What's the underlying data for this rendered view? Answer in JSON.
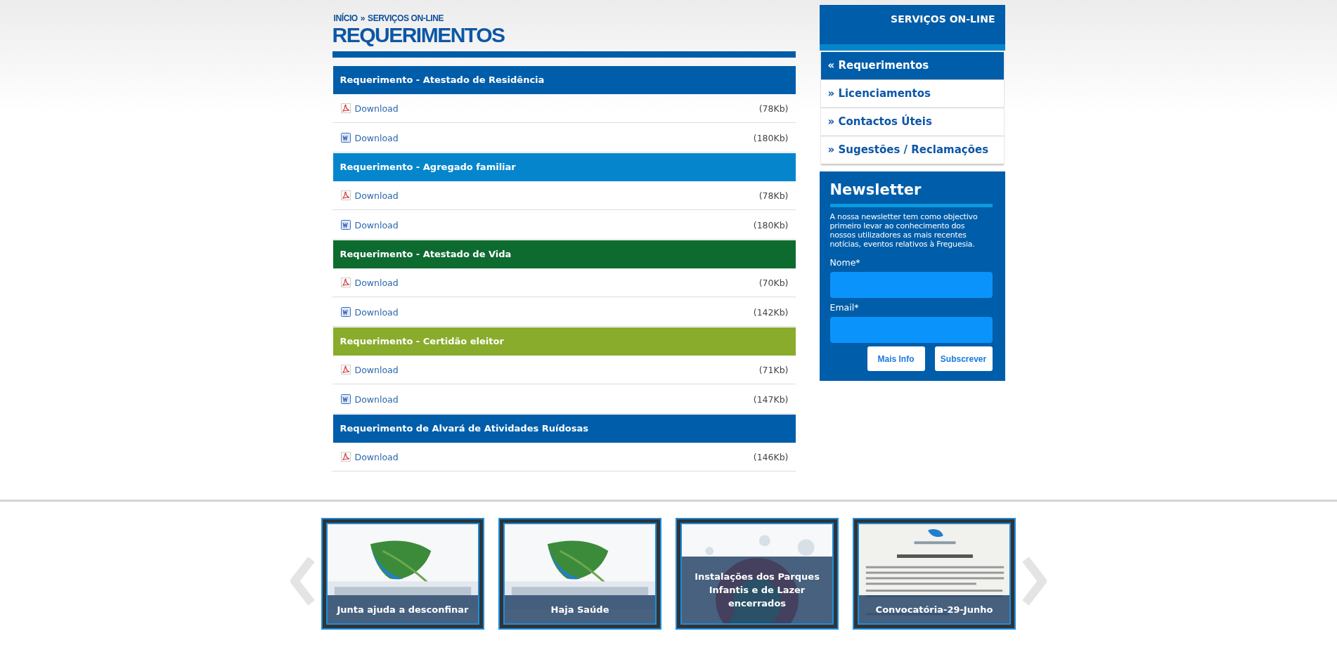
{
  "breadcrumb": [
    "INÍCIO",
    "»",
    "SERVIÇOS ON-LINE"
  ],
  "title": "REQUERIMENTOS",
  "sections": [
    {
      "title": "Requerimento - Atestado de Residência",
      "color": "#005da9",
      "files": [
        {
          "kind": "pdf",
          "label": "Download",
          "size": "(78Kb)"
        },
        {
          "kind": "word",
          "label": "Download",
          "size": "(180Kb)"
        }
      ]
    },
    {
      "title": "Requerimento - Agregado familiar",
      "color": "#0586cc",
      "files": [
        {
          "kind": "pdf",
          "label": "Download",
          "size": "(78Kb)"
        },
        {
          "kind": "word",
          "label": "Download",
          "size": "(180Kb)"
        }
      ]
    },
    {
      "title": "Requerimento - Atestado de Vida",
      "color": "#0e6b2f",
      "files": [
        {
          "kind": "pdf",
          "label": "Download",
          "size": "(70Kb)"
        },
        {
          "kind": "word",
          "label": "Download",
          "size": "(142Kb)"
        }
      ]
    },
    {
      "title": "Requerimento - Certidão eleitor",
      "color": "#89ac2c",
      "files": [
        {
          "kind": "pdf",
          "label": "Download",
          "size": "(71Kb)"
        },
        {
          "kind": "word",
          "label": "Download",
          "size": "(147Kb)"
        }
      ]
    },
    {
      "title": "Requerimento de Alvará de Atividades Ruídosas",
      "color": "#005da9",
      "files": [
        {
          "kind": "pdf",
          "label": "Download",
          "size": "(146Kb)"
        }
      ]
    }
  ],
  "sidebar": {
    "title": "SERVIÇOS ON-LINE",
    "items": [
      {
        "marker": "«",
        "label": "Requerimentos",
        "selected": true
      },
      {
        "marker": "»",
        "label": "Licenciamentos",
        "selected": false
      },
      {
        "marker": "»",
        "label": "Contactos Úteis",
        "selected": false
      },
      {
        "marker": "»",
        "label": "Sugestões / Reclamações",
        "selected": false
      }
    ]
  },
  "newsletter": {
    "title": "Newsletter",
    "text": "A nossa newsletter tem como objectivo primeiro levar ao conhecimento dos nossos utilizadores as mais recentes notícias, eventos relativos à Freguesia.",
    "fields": [
      {
        "label": "Nome*"
      },
      {
        "label": "Email*"
      }
    ],
    "buttons": [
      "Mais Info",
      "Subscrever"
    ]
  },
  "carousel": [
    {
      "kind": "picture",
      "caption": "Junta ajuda a desconfinar"
    },
    {
      "kind": "picture",
      "caption": "Haja Saúde"
    },
    {
      "kind": "picture",
      "caption": "Instalações dos Parques Infantis e de Lazer encerrados"
    },
    {
      "kind": "picture",
      "caption": "Convocatória-29-Junho"
    }
  ]
}
